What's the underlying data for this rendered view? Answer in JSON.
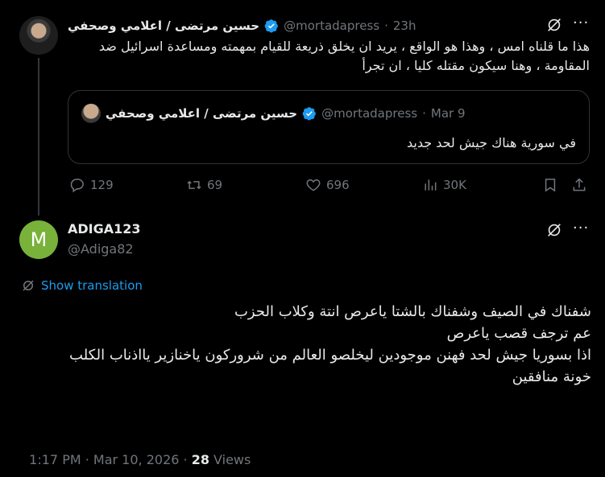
{
  "parent_tweet": {
    "author_name": "حسين مرتضى / اعلامي وصحفي",
    "handle": "@mortadapress",
    "separator": "·",
    "time": "23h",
    "text": "هذا ما قلناه امس ، وهذا هو الواقع ، يريد ان يخلق ذريعة للقيام بمهمته ومساعدة اسرائيل ضد المقاومة ، وهنا سيكون مقتله كليا ، ان تجرأ",
    "quote": {
      "author_name": "حسين مرتضى / اعلامي وصحفي",
      "handle": "@mortadapress",
      "separator": "·",
      "date": "Mar 9",
      "text": "في سورية هناك جيش لحد جديد"
    },
    "stats": {
      "replies": "129",
      "reposts": "69",
      "likes": "696",
      "views": "30K"
    }
  },
  "reply_tweet": {
    "avatar_letter": "M",
    "author_name": "ADIGA123",
    "handle": "@Adiga82",
    "show_translation": "Show translation",
    "lines": [
      "شفناك في الصيف وشفناك بالشتا ياعرص انتة وكلاب الحزب",
      "عم ترجف قصب ياعرص",
      "اذا بسوريا جيش لحد فهنن موجودين ليخلصو العالم من شروركون ياخنازير يااذناب الكلب",
      "خونة منافقين"
    ],
    "timestamp": "1:17 PM · Mar 10, 2026 · ",
    "views_count": "28",
    "views_label": " Views"
  },
  "colors": {
    "background": "#000000",
    "text": "#e7e9ea",
    "muted": "#71767b",
    "accent": "#1d9bf0",
    "avatar_green": "#78b23a"
  }
}
